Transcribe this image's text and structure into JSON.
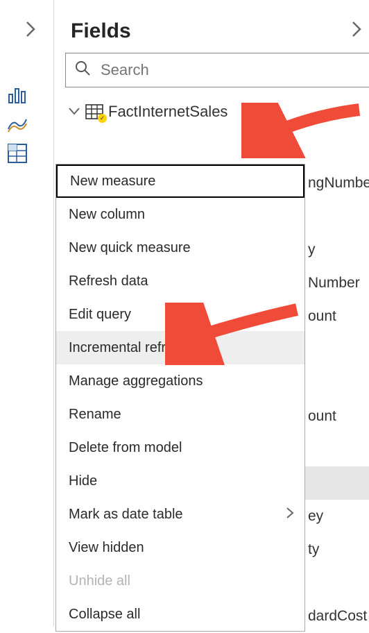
{
  "header": {
    "title": "Fields"
  },
  "search": {
    "placeholder": "Search"
  },
  "table": {
    "name": "FactInternetSales"
  },
  "fields": [
    {
      "label": "ngNumber",
      "selected": false
    },
    {
      "label": "",
      "selected": false
    },
    {
      "label": "y",
      "selected": false
    },
    {
      "label": "Number",
      "selected": false
    },
    {
      "label": "ount",
      "selected": false
    },
    {
      "label": "",
      "selected": false
    },
    {
      "label": "",
      "selected": false
    },
    {
      "label": "ount",
      "selected": false
    },
    {
      "label": "",
      "selected": false
    },
    {
      "label": "",
      "selected": true
    },
    {
      "label": "ey",
      "selected": false
    },
    {
      "label": "ty",
      "selected": false
    },
    {
      "label": "",
      "selected": false
    },
    {
      "label": "dardCost",
      "selected": false
    }
  ],
  "contextMenu": [
    {
      "label": "New measure",
      "first": true
    },
    {
      "label": "New column"
    },
    {
      "label": "New quick measure"
    },
    {
      "label": "Refresh data"
    },
    {
      "label": "Edit query"
    },
    {
      "label": "Incremental refresh",
      "hover": true
    },
    {
      "label": "Manage aggregations"
    },
    {
      "label": "Rename"
    },
    {
      "label": "Delete from model"
    },
    {
      "label": "Hide"
    },
    {
      "label": "Mark as date table",
      "submenu": true
    },
    {
      "label": "View hidden"
    },
    {
      "label": "Unhide all",
      "disabled": true
    },
    {
      "label": "Collapse all"
    }
  ]
}
